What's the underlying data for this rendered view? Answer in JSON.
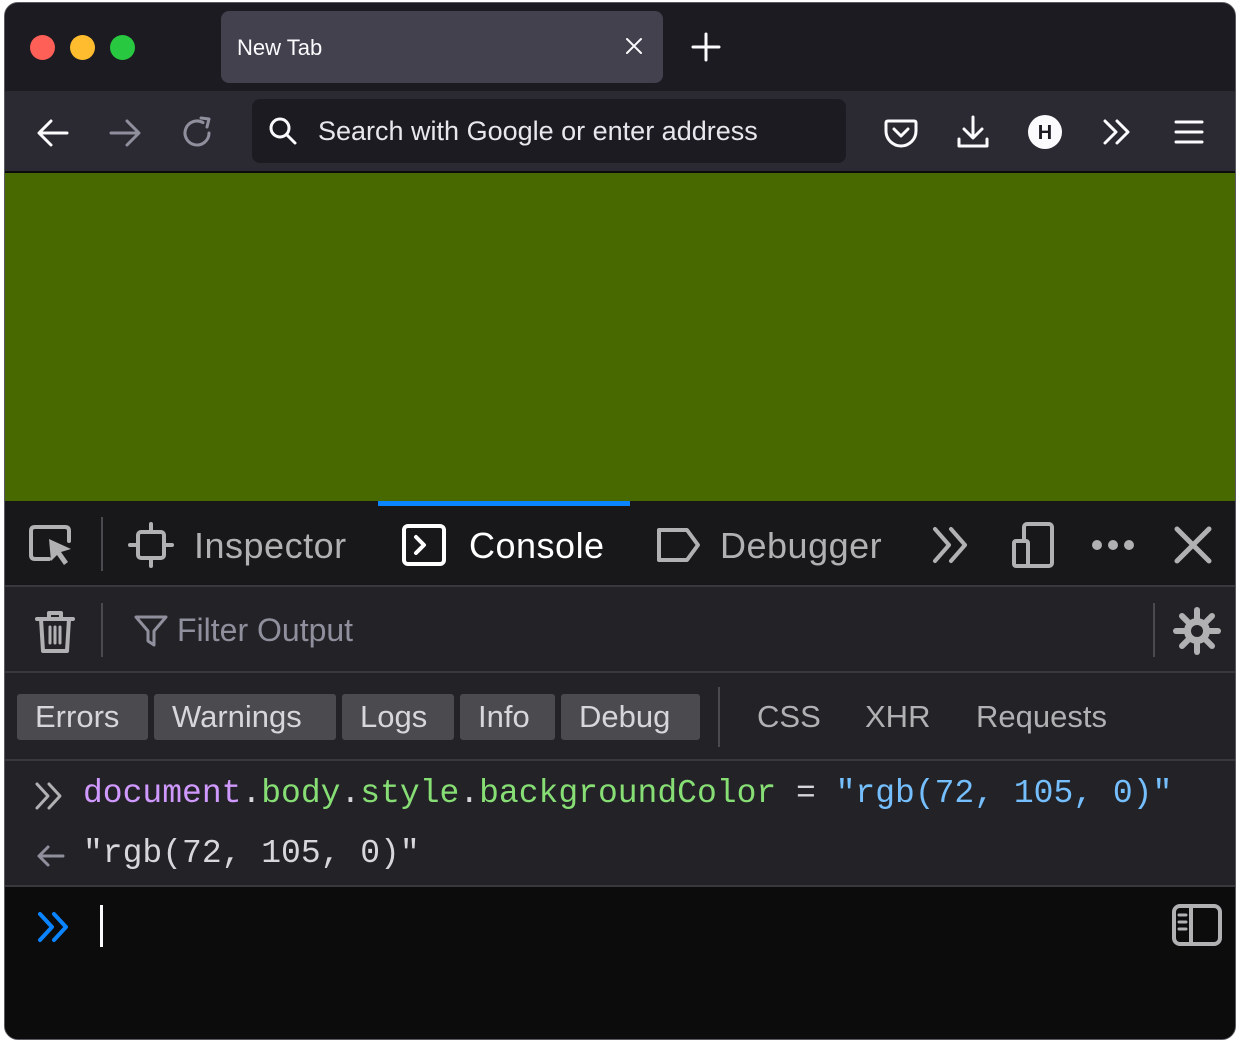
{
  "browser": {
    "tabs": [
      {
        "title": "New Tab",
        "active": true
      }
    ],
    "url_placeholder": "Search with Google or enter address",
    "page_background": "#486900",
    "account_initial": "H"
  },
  "devtools": {
    "tabs": [
      {
        "label": "Inspector",
        "selected": false
      },
      {
        "label": "Console",
        "selected": true
      },
      {
        "label": "Debugger",
        "selected": false
      }
    ],
    "filter_placeholder": "Filter Output",
    "level_filters": [
      "Errors",
      "Warnings",
      "Logs",
      "Info",
      "Debug"
    ],
    "other_filters": [
      "CSS",
      "XHR",
      "Requests"
    ],
    "console": {
      "command": {
        "object": "document",
        "dot1": ".",
        "prop1": "body",
        "dot2": ".",
        "prop2": "style",
        "dot3": ".",
        "prop3": "backgroundColor",
        "operator": " = ",
        "value": "\"rgb(72, 105, 0)\""
      },
      "result": "\"rgb(72, 105, 0)\""
    }
  },
  "colors": {
    "accent": "#0a84ff",
    "object_token": "#d099ff",
    "property_token": "#86de74",
    "string_token": "#75bfff"
  }
}
